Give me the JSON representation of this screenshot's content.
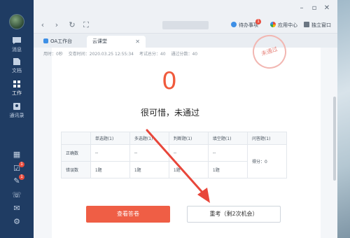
{
  "sidebar": {
    "items": [
      {
        "label": "消息",
        "icon": "message-icon"
      },
      {
        "label": "文档",
        "icon": "document-icon"
      },
      {
        "label": "工作",
        "icon": "work-icon"
      },
      {
        "label": "通讯录",
        "icon": "contacts-icon"
      }
    ],
    "bottom_icons": [
      {
        "icon": "calendar-icon"
      },
      {
        "icon": "tasks-icon",
        "badge": "1"
      },
      {
        "icon": "alert-icon",
        "badge": "1"
      },
      {
        "icon": "phone-icon"
      },
      {
        "icon": "mail-icon"
      },
      {
        "icon": "settings-icon"
      }
    ]
  },
  "toolbar": {
    "todo": "待办事项",
    "todo_badge": "1",
    "app_center": "应用中心",
    "standalone": "独立窗口"
  },
  "tabs": [
    {
      "label": "OA工作台"
    },
    {
      "label": "云课堂",
      "active": true
    }
  ],
  "exam": {
    "meta": [
      "用时：0秒",
      "交卷时间：2020.03.25 12:55:34",
      "考试总分：40",
      "通过分数：40"
    ],
    "stamp": "未通过",
    "score": "0",
    "result": "很可惜，未通过"
  },
  "stats": {
    "headers": [
      "",
      "单选题(1)",
      "多选题(1)",
      "判断题(1)",
      "填空题(1)",
      "问答题(1)"
    ],
    "rows": [
      {
        "label": "正确数",
        "values": [
          "--",
          "--",
          "--",
          "--"
        ]
      },
      {
        "label": "错误数",
        "values": [
          "1题",
          "1题",
          "1题",
          "1题"
        ]
      }
    ],
    "essay_score": "得分：0"
  },
  "buttons": {
    "view_answers": "查看答卷",
    "retake": "重考（剩2次机会）"
  }
}
